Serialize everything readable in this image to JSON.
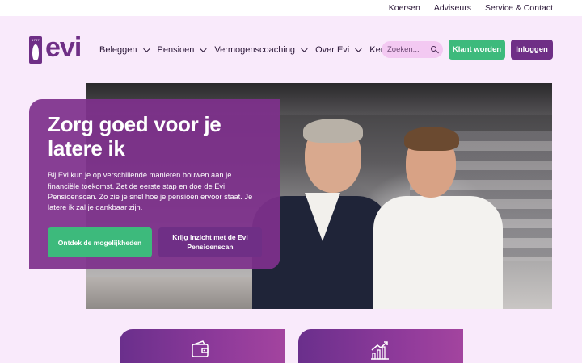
{
  "topbar": {
    "links": [
      "Koersen",
      "Adviseurs",
      "Service & Contact"
    ]
  },
  "logo": {
    "year": "1737",
    "word": "evi"
  },
  "nav": {
    "items": [
      {
        "label": "Beleggen",
        "dropdown": true
      },
      {
        "label": "Pensioen",
        "dropdown": true
      },
      {
        "label": "Vermogenscoaching",
        "dropdown": true
      },
      {
        "label": "Over Evi",
        "dropdown": true
      },
      {
        "label": "Kennis",
        "dropdown": false
      }
    ]
  },
  "search": {
    "placeholder": "Zoeken...",
    "icon": "search-icon"
  },
  "header_buttons": {
    "signup": "Klant worden",
    "login": "Inloggen"
  },
  "hero": {
    "title": "Zorg goed voor je latere ik",
    "text": "Bij Evi kun je op verschillende manieren bouwen aan je financiële toekomst. Zet de eerste stap en doe de Evi Pensioenscan. Zo zie je snel hoe je pensioen ervoor staat. Je latere ik zal je dankbaar zijn.",
    "primary_button": "Ontdek de mogelijkheden",
    "secondary_button": "Krijg inzicht met de Evi Pensioenscan"
  },
  "features": [
    {
      "icon": "wallet-icon"
    },
    {
      "icon": "growth-chart-icon"
    }
  ],
  "colors": {
    "brand_purple": "#6f2f86",
    "accent_green": "#3dba7c",
    "background": "#f9eafb",
    "search_pink": "#f3c9f2"
  }
}
